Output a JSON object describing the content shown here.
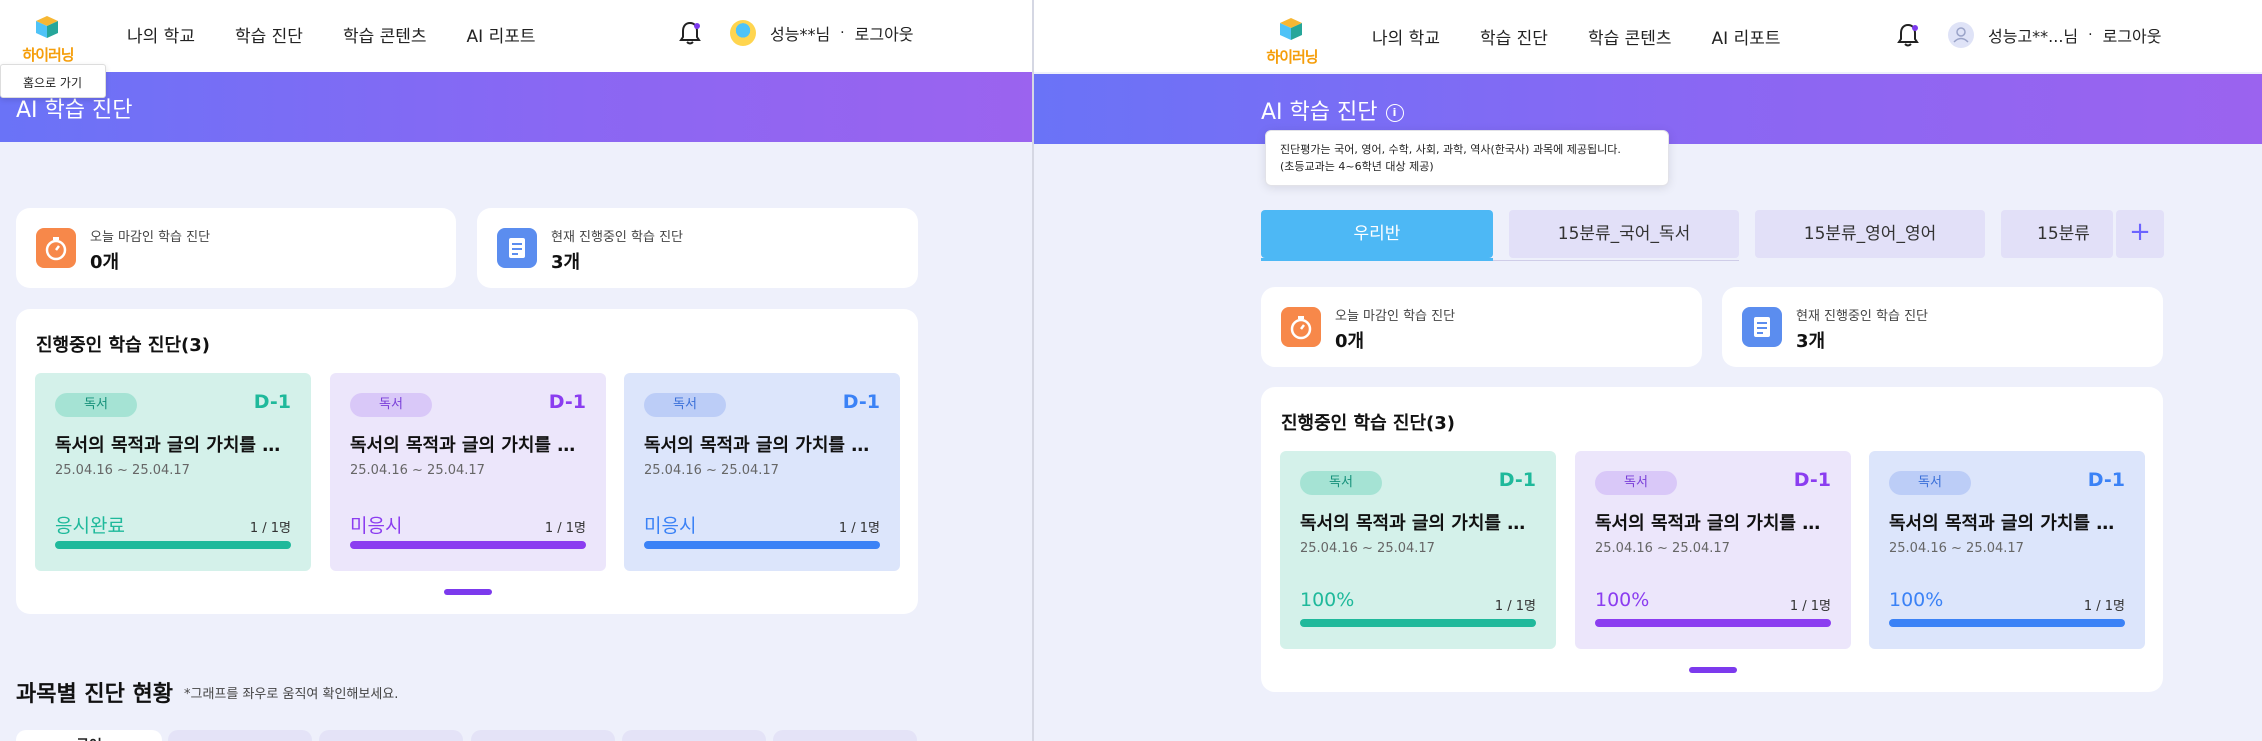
{
  "left": {
    "nav": {
      "logo_text": "하이러닝",
      "menu": [
        "나의 학교",
        "학습 진단",
        "학습 콘텐츠",
        "AI 리포트"
      ],
      "user": "성능**님",
      "logout": "로그아웃"
    },
    "home_tip": "홈으로 가기",
    "banner_title": "AI 학습 진단",
    "stats": [
      {
        "label": "오늘 마감인 학습 진단",
        "value": "0개"
      },
      {
        "label": "현재 진행중인 학습 진단",
        "value": "3개"
      }
    ],
    "panel_title": "진행중인 학습 진단(3)",
    "cards": [
      {
        "badge": "독서",
        "dday": "D-1",
        "title": "독서의 목적과 글의 가치를 …",
        "date": "25.04.16 ~ 25.04.17",
        "status": "응시완료",
        "count": "1 / 1명",
        "progress": 1.0
      },
      {
        "badge": "독서",
        "dday": "D-1",
        "title": "독서의 목적과 글의 가치를 …",
        "date": "25.04.16 ~ 25.04.17",
        "status": "미응시",
        "count": "1 / 1명",
        "progress": 1.0
      },
      {
        "badge": "독서",
        "dday": "D-1",
        "title": "독서의 목적과 글의 가치를 …",
        "date": "25.04.16 ~ 25.04.17",
        "status": "미응시",
        "count": "1 / 1명",
        "progress": 1.0
      }
    ],
    "section_title": "과목별 진단 현황",
    "section_note": "*그래프를 좌우로 움직여 확인해보세요.",
    "subject_tab_active": "국어"
  },
  "right": {
    "nav": {
      "logo_text": "하이러닝",
      "menu": [
        "나의 학교",
        "학습 진단",
        "학습 콘텐츠",
        "AI 리포트"
      ],
      "user": "성능고**...님",
      "logout": "로그아웃"
    },
    "banner_title": "AI 학습 진단",
    "tooltip": {
      "line1": "진단평가는 국어, 영어, 수학, 사회, 과학, 역사(한국사) 과목에 제공됩니다.",
      "line2": "(초등교과는 4~6학년 대상 제공)"
    },
    "class_tabs": [
      "우리반",
      "15분류_국어_독서",
      "15분류_영어_영어",
      "15분류"
    ],
    "add_tab": "+",
    "stats": [
      {
        "label": "오늘 마감인 학습 진단",
        "value": "0개"
      },
      {
        "label": "현재 진행중인 학습 진단",
        "value": "3개"
      }
    ],
    "panel_title": "진행중인 학습 진단(3)",
    "cards": [
      {
        "badge": "독서",
        "dday": "D-1",
        "title": "독서의 목적과 글의 가치를 …",
        "date": "25.04.16 ~ 25.04.17",
        "status": "100%",
        "count": "1 / 1명",
        "progress": 1.0
      },
      {
        "badge": "독서",
        "dday": "D-1",
        "title": "독서의 목적과 글의 가치를 …",
        "date": "25.04.16 ~ 25.04.17",
        "status": "100%",
        "count": "1 / 1명",
        "progress": 1.0
      },
      {
        "badge": "독서",
        "dday": "D-1",
        "title": "독서의 목적과 글의 가치를 …",
        "date": "25.04.16 ~ 25.04.17",
        "status": "100%",
        "count": "1 / 1명",
        "progress": 1.0
      }
    ]
  },
  "colors": {
    "accent_purple": "#7c3aed",
    "banner_start": "#6a73f7",
    "banner_end": "#9b63ef",
    "teal": "#1fb99b",
    "violet": "#8b3df0",
    "blue": "#3b82f6",
    "tab_blue": "#4db8f5",
    "stat_orange": "#f7884a",
    "stat_blue": "#5b8def"
  },
  "icons": [
    "logo-cube-icon",
    "bell-icon",
    "avatar-icon",
    "timer-icon",
    "document-icon",
    "info-icon",
    "plus-icon"
  ]
}
